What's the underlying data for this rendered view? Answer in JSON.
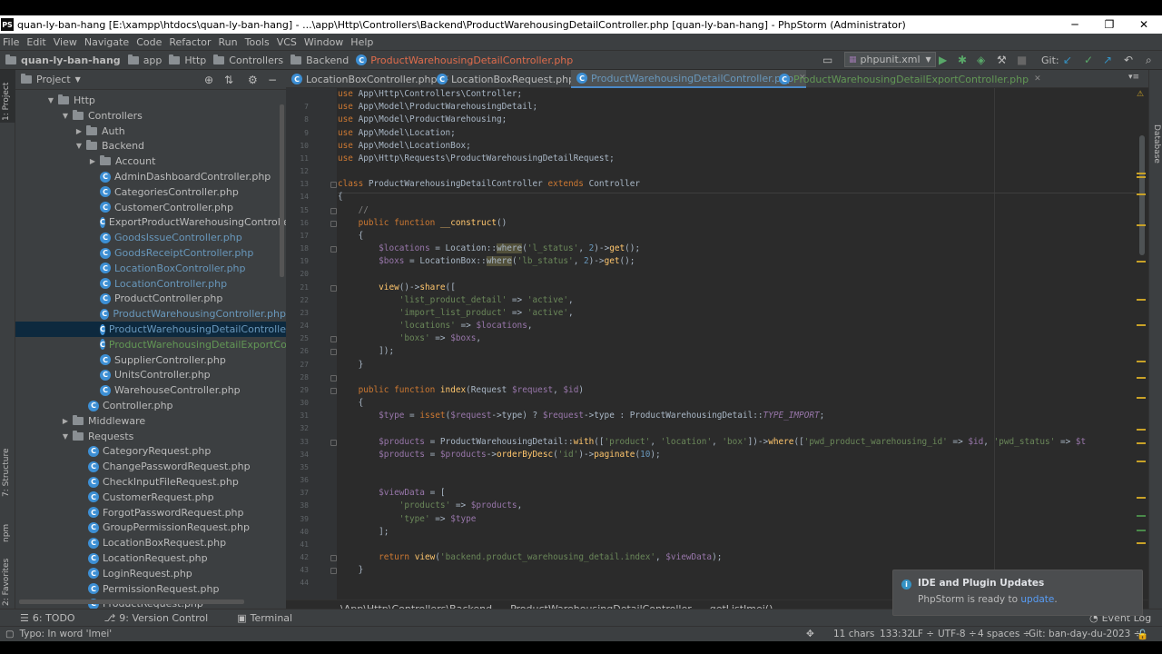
{
  "window": {
    "title": "quan-ly-ban-hang [E:\\xampp\\htdocs\\quan-ly-ban-hang] - ...\\app\\Http\\Controllers\\Backend\\ProductWarehousingDetailController.php [quan-ly-ban-hang] - PhpStorm (Administrator)",
    "minimize": "─",
    "maximize": "❐",
    "close": "✕"
  },
  "menu": [
    "File",
    "Edit",
    "View",
    "Navigate",
    "Code",
    "Refactor",
    "Run",
    "Tools",
    "VCS",
    "Window",
    "Help"
  ],
  "breadcrumbs": [
    "quan-ly-ban-hang",
    "app",
    "Http",
    "Controllers",
    "Backend",
    "ProductWarehousingDetailController.php"
  ],
  "toolbar": {
    "run_config": "phpunit.xml",
    "git_label": "Git:"
  },
  "project_panel": {
    "title": "Project",
    "rows": [
      {
        "label": "Http",
        "kind": "folder",
        "level": 2,
        "expanded": true
      },
      {
        "label": "Controllers",
        "kind": "folder",
        "level": 3,
        "expanded": true
      },
      {
        "label": "Auth",
        "kind": "folder",
        "level": 4,
        "expanded": false
      },
      {
        "label": "Backend",
        "kind": "folder",
        "level": 4,
        "expanded": true
      },
      {
        "label": "Account",
        "kind": "folder",
        "level": 5,
        "expanded": false
      },
      {
        "label": "AdminDashboardController.php",
        "kind": "class",
        "level": 6,
        "color": "#bbbbbb"
      },
      {
        "label": "CategoriesController.php",
        "kind": "class",
        "level": 6,
        "color": "#bbbbbb"
      },
      {
        "label": "CustomerController.php",
        "kind": "class",
        "level": 6,
        "color": "#bbbbbb"
      },
      {
        "label": "ExportProductWarehousingController.php",
        "kind": "class",
        "level": 6,
        "color": "#bbbbbb"
      },
      {
        "label": "GoodsIssueController.php",
        "kind": "class",
        "level": 6,
        "color": "#6897bb"
      },
      {
        "label": "GoodsReceiptController.php",
        "kind": "class",
        "level": 6,
        "color": "#6897bb"
      },
      {
        "label": "LocationBoxController.php",
        "kind": "class",
        "level": 6,
        "color": "#6897bb"
      },
      {
        "label": "LocationController.php",
        "kind": "class",
        "level": 6,
        "color": "#6897bb"
      },
      {
        "label": "ProductController.php",
        "kind": "class",
        "level": 6,
        "color": "#bbbbbb"
      },
      {
        "label": "ProductWarehousingController.php",
        "kind": "class",
        "level": 6,
        "color": "#6897bb"
      },
      {
        "label": "ProductWarehousingDetailController.php",
        "kind": "class",
        "level": 6,
        "color": "#6897bb",
        "selected": true
      },
      {
        "label": "ProductWarehousingDetailExportController.php",
        "kind": "class",
        "level": 6,
        "color": "#629755"
      },
      {
        "label": "SupplierController.php",
        "kind": "class",
        "level": 6,
        "color": "#bbbbbb"
      },
      {
        "label": "UnitsController.php",
        "kind": "class",
        "level": 6,
        "color": "#bbbbbb"
      },
      {
        "label": "WarehouseController.php",
        "kind": "class",
        "level": 6,
        "color": "#bbbbbb"
      },
      {
        "label": "Controller.php",
        "kind": "class",
        "level": 5,
        "color": "#bbbbbb"
      },
      {
        "label": "Middleware",
        "kind": "folder",
        "level": 3,
        "expanded": false
      },
      {
        "label": "Requests",
        "kind": "folder",
        "level": 3,
        "expanded": true
      },
      {
        "label": "CategoryRequest.php",
        "kind": "class",
        "level": 5,
        "color": "#bbbbbb"
      },
      {
        "label": "ChangePasswordRequest.php",
        "kind": "class",
        "level": 5,
        "color": "#bbbbbb"
      },
      {
        "label": "CheckInputFileRequest.php",
        "kind": "class",
        "level": 5,
        "color": "#bbbbbb"
      },
      {
        "label": "CustomerRequest.php",
        "kind": "class",
        "level": 5,
        "color": "#bbbbbb"
      },
      {
        "label": "ForgotPasswordRequest.php",
        "kind": "class",
        "level": 5,
        "color": "#bbbbbb"
      },
      {
        "label": "GroupPermissionRequest.php",
        "kind": "class",
        "level": 5,
        "color": "#bbbbbb"
      },
      {
        "label": "LocationBoxRequest.php",
        "kind": "class",
        "level": 5,
        "color": "#bbbbbb"
      },
      {
        "label": "LocationRequest.php",
        "kind": "class",
        "level": 5,
        "color": "#bbbbbb"
      },
      {
        "label": "LoginRequest.php",
        "kind": "class",
        "level": 5,
        "color": "#bbbbbb"
      },
      {
        "label": "PermissionRequest.php",
        "kind": "class",
        "level": 5,
        "color": "#bbbbbb"
      },
      {
        "label": "ProductRequest.php",
        "kind": "class",
        "level": 5,
        "color": "#bbbbbb"
      }
    ]
  },
  "tabs": [
    {
      "label": "LocationBoxController.php",
      "color": "#bbbbbb"
    },
    {
      "label": "LocationBoxRequest.php",
      "color": "#bbbbbb"
    },
    {
      "label": "ProductWarehousingDetailController.php",
      "color": "#6897bb",
      "active": true
    },
    {
      "label": "ProductWarehousingDetailExportController.php",
      "color": "#629755"
    }
  ],
  "code_lines": [
    {
      "n": "",
      "html": "<span class=\"kw\">use</span> App\\Http\\Controllers\\Controller;"
    },
    {
      "n": "7",
      "html": "<span class=\"kw\">use</span> App\\Model\\ProductWarehousingDetail;"
    },
    {
      "n": "8",
      "html": "<span class=\"kw\">use</span> App\\Model\\ProductWarehousing;"
    },
    {
      "n": "9",
      "html": "<span class=\"kw\">use</span> App\\Model\\Location;"
    },
    {
      "n": "10",
      "html": "<span class=\"kw\">use</span> App\\Model\\LocationBox;"
    },
    {
      "n": "11",
      "html": "<span class=\"kw\">use</span> App\\Http\\Requests\\ProductWarehousingDetailRequest;"
    },
    {
      "n": "12",
      "html": ""
    },
    {
      "n": "13",
      "html": "<span class=\"kw\">class</span> ProductWarehousingDetailController <span class=\"kw\">extends</span> Controller"
    },
    {
      "n": "14",
      "html": "{"
    },
    {
      "n": "15",
      "html": "    <span class=\"cm\">//</span>"
    },
    {
      "n": "16",
      "html": "    <span class=\"kw\">public function</span> <span class=\"fn\">__construct</span>()"
    },
    {
      "n": "17",
      "html": "    {"
    },
    {
      "n": "18",
      "html": "        <span class=\"vr\">$locations</span> = Location::<span class=\"hl\">where</span>(<span class=\"st\">'l_status'</span>, <span class=\"nm\">2</span>)-><span class=\"fn\">get</span>();"
    },
    {
      "n": "19",
      "html": "        <span class=\"vr\">$boxs</span> = LocationBox::<span class=\"hl\">where</span>(<span class=\"st\">'lb_status'</span>, <span class=\"nm\">2</span>)-><span class=\"fn\">get</span>();"
    },
    {
      "n": "20",
      "html": ""
    },
    {
      "n": "21",
      "html": "        <span class=\"fn\">view</span>()-><span class=\"fn\">share</span>(["
    },
    {
      "n": "22",
      "html": "            <span class=\"st\">'list_product_detail'</span> => <span class=\"st\">'active'</span>,"
    },
    {
      "n": "23",
      "html": "            <span class=\"st\">'import_list_product'</span> => <span class=\"st\">'active'</span>,"
    },
    {
      "n": "24",
      "html": "            <span class=\"st\">'locations'</span> => <span class=\"vr\">$locations</span>,"
    },
    {
      "n": "25",
      "html": "            <span class=\"st\">'boxs'</span> => <span class=\"vr\">$boxs</span>,"
    },
    {
      "n": "26",
      "html": "        ]);"
    },
    {
      "n": "27",
      "html": "    }"
    },
    {
      "n": "28",
      "html": ""
    },
    {
      "n": "29",
      "html": "    <span class=\"kw\">public function</span> <span class=\"fn\">index</span>(Request <span class=\"vr\">$request</span>, <span class=\"vr\">$id</span>)"
    },
    {
      "n": "30",
      "html": "    {"
    },
    {
      "n": "31",
      "html": "        <span class=\"vr\">$type</span> = <span class=\"kw\">isset</span>(<span class=\"vr\">$request</span>->type) ? <span class=\"vr\">$request</span>->type : ProductWarehousingDetail::<span class=\"it\">TYPE_IMPORT</span>;"
    },
    {
      "n": "32",
      "html": ""
    },
    {
      "n": "33",
      "html": "        <span class=\"vr\">$products</span> = ProductWarehousingDetail::<span class=\"fn\">with</span>([<span class=\"st\">'product'</span>, <span class=\"st\">'location'</span>, <span class=\"st\">'box'</span>])-><span class=\"fn\">where</span>([<span class=\"st\">'pwd_product_warehousing_id'</span> => <span class=\"vr\">$id</span>, <span class=\"st\">'pwd_status'</span> => <span class=\"vr\">$t</span>"
    },
    {
      "n": "34",
      "html": "        <span class=\"vr\">$products</span> = <span class=\"vr\">$products</span>-><span class=\"fn\">orderByDesc</span>(<span class=\"st\">'id'</span>)-><span class=\"fn\">paginate</span>(<span class=\"nm\">10</span>);"
    },
    {
      "n": "35",
      "html": ""
    },
    {
      "n": "36",
      "html": ""
    },
    {
      "n": "37",
      "html": "        <span class=\"vr\">$viewData</span> = ["
    },
    {
      "n": "38",
      "html": "            <span class=\"st\">'products'</span> => <span class=\"vr\">$products</span>,"
    },
    {
      "n": "39",
      "html": "            <span class=\"st\">'type'</span> => <span class=\"vr\">$type</span>"
    },
    {
      "n": "40",
      "html": "        ];"
    },
    {
      "n": "41",
      "html": ""
    },
    {
      "n": "42",
      "html": "        <span class=\"kw\">return</span> <span class=\"fn\">view</span>(<span class=\"st\">'backend.product_warehousing_detail.index'</span>, <span class=\"vr\">$viewData</span>);"
    },
    {
      "n": "43",
      "html": "    }"
    },
    {
      "n": "44",
      "html": ""
    }
  ],
  "editor_breadcrumb": [
    "\\App\\Http\\Controllers\\Backend",
    "ProductWarehousingDetailController",
    "getListImei()"
  ],
  "tool_windows": [
    {
      "label": "6: TODO",
      "icon": "☰"
    },
    {
      "label": "9: Version Control",
      "icon": "⎇"
    },
    {
      "label": "Terminal",
      "icon": "▣"
    }
  ],
  "event_log": "Event Log",
  "left_strip": [
    "1: Project",
    "7: Structure",
    "npm",
    "2: Favorites"
  ],
  "right_strip": [
    "Database"
  ],
  "status": {
    "message": "Typo: In word 'Imei'",
    "chars": "11 chars",
    "position": "133:32",
    "line_sep": "LF ÷",
    "encoding": "UTF-8 ÷",
    "indent": "4 spaces ÷",
    "branch": "Git: ban-day-du-2023 ÷"
  },
  "notification": {
    "title": "IDE and Plugin Updates",
    "body": "PhpStorm is ready to",
    "link": "update",
    "end": "."
  }
}
